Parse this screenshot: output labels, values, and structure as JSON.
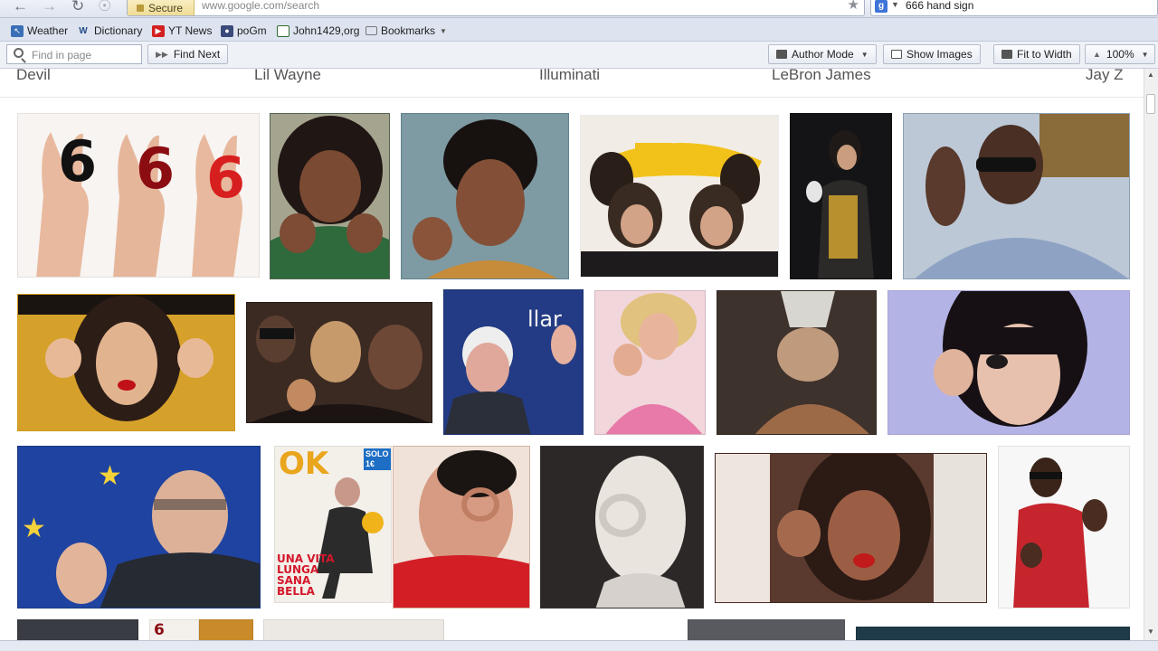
{
  "browser": {
    "back_icon": "back-arrow-icon",
    "security_label": "Secure",
    "url": "www.google.com/search",
    "search_engine_icon": "google-icon",
    "search_query": "666 hand sign"
  },
  "bookmarks": [
    {
      "label": "Weather",
      "icon": "weather-icon"
    },
    {
      "label": "Dictionary",
      "icon": "dictionary-icon"
    },
    {
      "label": "YT News",
      "icon": "youtube-icon"
    },
    {
      "label": "poGm",
      "icon": "pogm-icon"
    },
    {
      "label": "John1429,org",
      "icon": "book-icon"
    },
    {
      "label": "Bookmarks",
      "icon": "folder-icon"
    }
  ],
  "findbar": {
    "placeholder": "Find in page",
    "find_next": "Find Next",
    "author_mode": "Author Mode",
    "show_images": "Show Images",
    "fit_to_width": "Fit to Width",
    "zoom": "100%"
  },
  "related_searches": [
    "Devil",
    "Lil Wayne",
    "Illuminati",
    "LeBron James",
    "Jay Z"
  ],
  "tile_666": {
    "digits": [
      "6",
      "6",
      "6"
    ],
    "colors": [
      "#111111",
      "#8b0d12",
      "#d81f1f"
    ]
  },
  "magazine": {
    "brand": "OK",
    "badge": "SOLO 1€",
    "headline_lines": [
      "UNA VITA",
      "LUNGA",
      "SANA",
      "BELLA"
    ]
  }
}
